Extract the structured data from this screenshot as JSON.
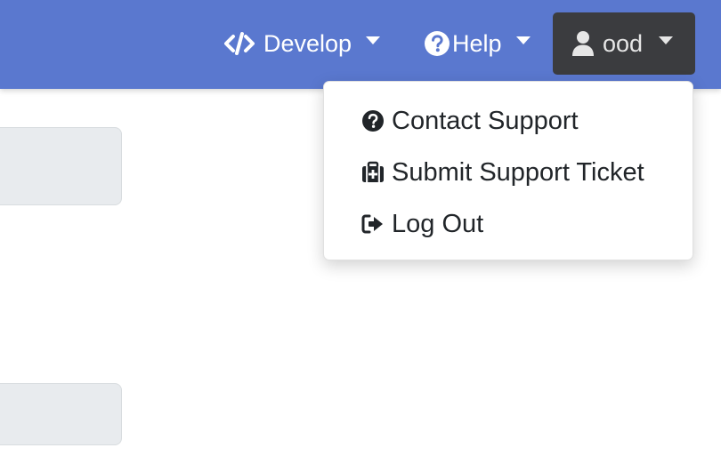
{
  "navbar": {
    "develop": {
      "label": "Develop",
      "icon": "code-icon"
    },
    "help": {
      "label": "Help",
      "icon": "question-circle-icon"
    },
    "user": {
      "label": "ood",
      "icon": "user-icon"
    }
  },
  "user_menu": {
    "items": [
      {
        "label": "Contact Support",
        "icon": "question-circle-icon"
      },
      {
        "label": "Submit Support Ticket",
        "icon": "medkit-icon"
      },
      {
        "label": "Log Out",
        "icon": "sign-out-icon"
      }
    ]
  },
  "colors": {
    "navbar_background": "#5a78cf",
    "active_user_button": "#3b3c3f",
    "menu_text": "#212529",
    "background_panel": "#e8ebee"
  }
}
